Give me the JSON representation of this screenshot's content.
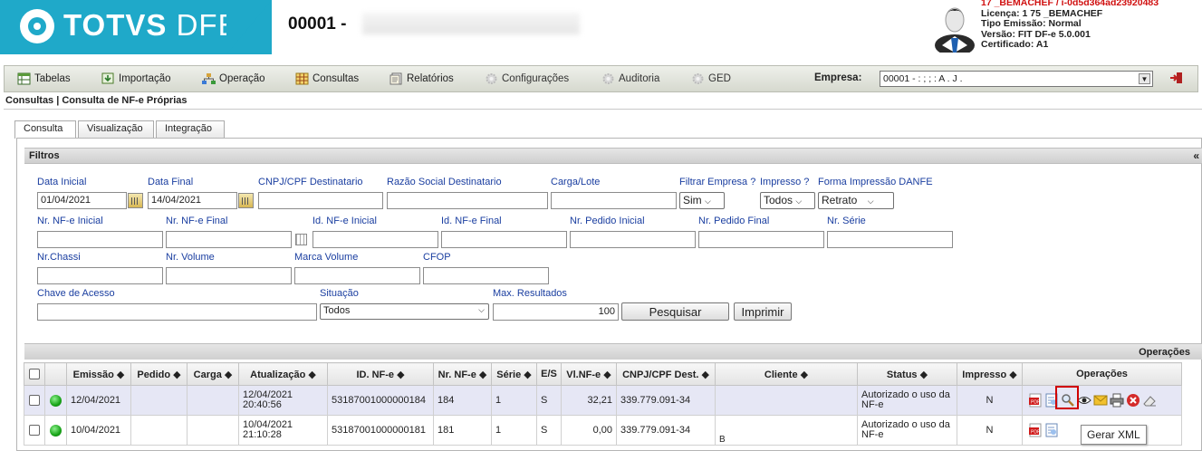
{
  "header": {
    "logo_text_bold": "TOTVS",
    "logo_text_thin": " DFE",
    "company_title": "00001 -",
    "user": {
      "line1": "17     _BEMACHEF / i-0d5d364ad23920483",
      "line2": "Licença: 1  75   _BEMACHEF",
      "line3": "Tipo Emissão: Normal",
      "line4": "Versão: FIT DF-e 5.0.001",
      "line5": "Certificado: A1"
    }
  },
  "menu": {
    "items": [
      {
        "label": "Tabelas",
        "icon": "table-icon"
      },
      {
        "label": "Importação",
        "icon": "import-icon"
      },
      {
        "label": "Operação",
        "icon": "network-icon"
      },
      {
        "label": "Consultas",
        "icon": "grid-icon"
      },
      {
        "label": "Relatórios",
        "icon": "report-icon"
      },
      {
        "label": "Configurações",
        "icon": "gear-icon"
      },
      {
        "label": "Auditoria",
        "icon": "gear-icon"
      },
      {
        "label": "GED",
        "icon": "gear-icon"
      }
    ],
    "empresa_label": "Empresa:",
    "empresa_value": "00001 -    :     ;  ;  :   A  .   J   ."
  },
  "breadcrumb": "Consultas | Consulta de NF-e Próprias",
  "tabs": [
    "Consulta",
    "Visualização",
    "Integração"
  ],
  "filters": {
    "title": "Filtros",
    "collapse": "«",
    "data_inicial_label": "Data Inicial",
    "data_inicial": "01/04/2021",
    "data_final_label": "Data Final",
    "data_final": "14/04/2021",
    "cnpj_label": "CNPJ/CPF Destinatario",
    "razao_label": "Razão Social Destinatario",
    "carga_label": "Carga/Lote",
    "filtrar_empresa_label": "Filtrar Empresa ?",
    "filtrar_empresa": "Sim",
    "impresso_label": "Impresso ?",
    "impresso": "Todos",
    "forma_label": "Forma Impressão DANFE",
    "forma": "Retrato",
    "nr_inicial_label": "Nr. NF-e Inicial",
    "nr_final_label": "Nr. NF-e Final",
    "id_inicial_label": "Id. NF-e Inicial",
    "id_final_label": "Id. NF-e Final",
    "pedido_inicial_label": "Nr. Pedido Inicial",
    "pedido_final_label": "Nr. Pedido Final",
    "serie_label": "Nr. Série",
    "chassi_label": "Nr.Chassi",
    "volume_label": "Nr. Volume",
    "marca_label": "Marca Volume",
    "cfop_label": "CFOP",
    "chave_label": "Chave de Acesso",
    "situacao_label": "Situação",
    "situacao": "Todos",
    "max_label": "Max. Resultados",
    "max_value": "100",
    "pesquisar": "Pesquisar",
    "imprimir": "Imprimir"
  },
  "results": {
    "bar_label": "Operações",
    "columns": [
      "Emissão",
      "Pedido",
      "Carga",
      "Atualização",
      "ID. NF-e",
      "Nr. NF-e",
      "Série",
      "E/S",
      "Vl.NF-e",
      "CNPJ/CPF Dest.",
      "Cliente",
      "Status",
      "Impresso",
      "Operações"
    ],
    "rows": [
      {
        "emissao": "12/04/2021",
        "pedido": "",
        "carga": "",
        "atualizacao": "12/04/2021 20:40:56",
        "id": "53187001000000184",
        "nr": "184",
        "serie": "1",
        "es": "S",
        "valor": "32,21",
        "cnpj": "339.779.091-34",
        "cliente": "",
        "status": "Autorizado o uso da NF-e",
        "impresso": "N"
      },
      {
        "emissao": "10/04/2021",
        "pedido": "",
        "carga": "",
        "atualizacao": "10/04/2021 21:10:28",
        "id": "53187001000000181",
        "nr": "181",
        "serie": "1",
        "es": "S",
        "valor": "0,00",
        "cnpj": "339.779.091-34",
        "cliente": "B",
        "status": "Autorizado o uso da NF-e",
        "impresso": "N"
      }
    ],
    "op_icons": [
      "pdf-icon",
      "xml-icon",
      "search-icon",
      "eye-icon",
      "email-icon",
      "printer-icon",
      "cancel-icon",
      "eraser-icon"
    ]
  },
  "tooltip": "Gerar XML"
}
